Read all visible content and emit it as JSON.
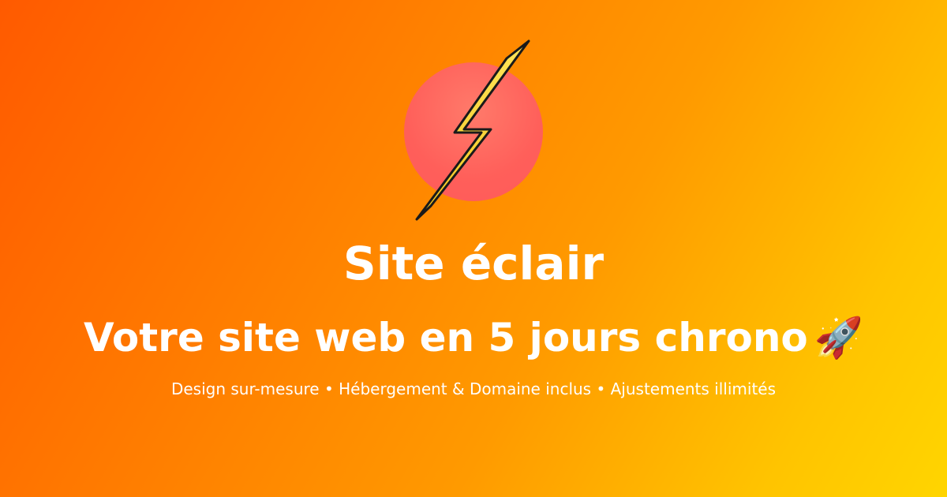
{
  "banner": {
    "title": "Site éclair",
    "tagline": "Votre site web en 5 jours chrono",
    "tagline_emoji": "🚀",
    "features": "Design sur-mesure • Hébergement & Domaine inclus • Ajustements illimités",
    "logo_icon": "lightning-bolt-icon",
    "colors": {
      "gradient_start": "#ff5a00",
      "gradient_end": "#ffd500",
      "circle": "#ff5f5a",
      "bolt": "#f6d32a",
      "text": "#ffffff"
    }
  }
}
